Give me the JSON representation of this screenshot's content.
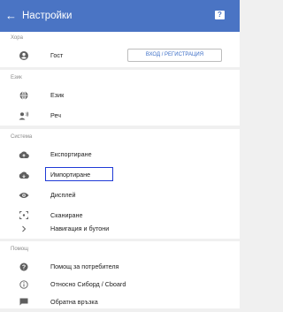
{
  "header": {
    "back_icon": "arrow-left-icon",
    "title": "Настройки",
    "help_icon": "help-icon"
  },
  "sections": {
    "account": {
      "title": "Хора",
      "user": {
        "icon": "account-circle-icon",
        "label": "Гост",
        "button": "ВХОД / РЕГИСТРАЦИЯ"
      }
    },
    "language": {
      "title": "Език",
      "items": [
        {
          "icon": "globe-icon",
          "label": "Език"
        },
        {
          "icon": "voice-icon",
          "label": "Реч"
        }
      ]
    },
    "system": {
      "title": "Система",
      "items": [
        {
          "icon": "cloud-upload-icon",
          "label": "Експортиране"
        },
        {
          "icon": "cloud-download-icon",
          "label": "Импортиране",
          "highlighted": true
        },
        {
          "icon": "eye-icon",
          "label": "Дисплей"
        },
        {
          "icon": "scan-icon",
          "label": "Сканиране"
        },
        {
          "icon": "chevron-right-icon",
          "label": "Навигация и бутони"
        }
      ]
    },
    "help": {
      "title": "Помощ",
      "items": [
        {
          "icon": "help-circle-icon",
          "label": "Помощ за потребителя"
        },
        {
          "icon": "info-icon",
          "label": "Относно Сиборд / Cboard"
        },
        {
          "icon": "feedback-icon",
          "label": "Обратна връзка"
        }
      ]
    }
  },
  "colors": {
    "primary": "#4a74c4",
    "highlight": "#1f3ad6",
    "icon": "#5f5f5f"
  }
}
